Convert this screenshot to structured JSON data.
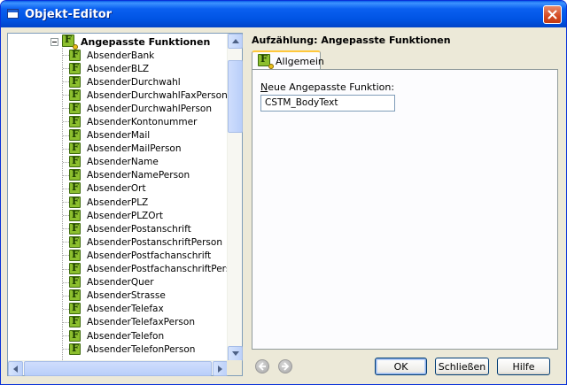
{
  "window": {
    "title": "Objekt-Editor"
  },
  "tree": {
    "root_label": "Angepasste Funktionen",
    "items": [
      "AbsenderBank",
      "AbsenderBLZ",
      "AbsenderDurchwahl",
      "AbsenderDurchwahlFaxPerson",
      "AbsenderDurchwahlPerson",
      "AbsenderKontonummer",
      "AbsenderMail",
      "AbsenderMailPerson",
      "AbsenderName",
      "AbsenderNamePerson",
      "AbsenderOrt",
      "AbsenderPLZ",
      "AbsenderPLZOrt",
      "AbsenderPostanschrift",
      "AbsenderPostanschriftPerson",
      "AbsenderPostfachanschrift",
      "AbsenderPostfachanschriftPers",
      "AbsenderQuer",
      "AbsenderStrasse",
      "AbsenderTelefax",
      "AbsenderTelefaxPerson",
      "AbsenderTelefon",
      "AbsenderTelefonPerson"
    ]
  },
  "details": {
    "heading": "Aufzählung: Angepasste Funktionen",
    "tab_label": "Allgemein",
    "field_label_accel": "N",
    "field_label_rest": "eue Angepasste Funktion:",
    "field_value": "CSTM_BodyText"
  },
  "buttons": {
    "ok": "OK",
    "close": "Schließen",
    "help": "Hilfe"
  }
}
